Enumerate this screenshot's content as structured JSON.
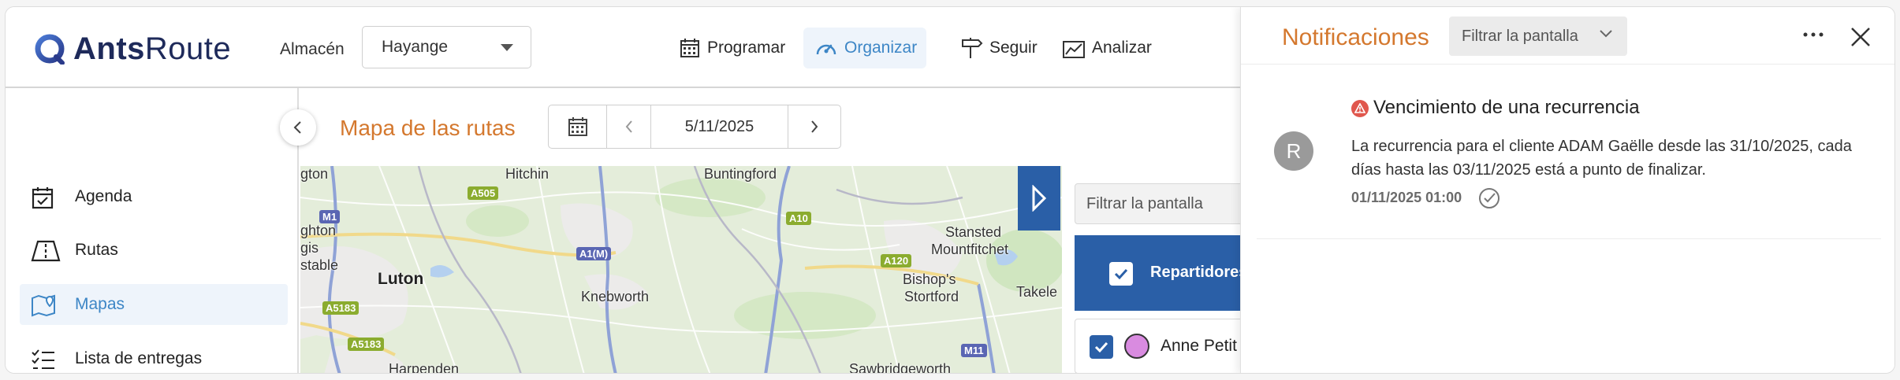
{
  "header": {
    "brand_bold": "Ants",
    "brand_light": "Route",
    "warehouse_label": "Almacén",
    "warehouse_value": "Hayange",
    "nav": [
      {
        "label": "Programar",
        "icon": "calendar-grid-icon"
      },
      {
        "label": "Organizar",
        "icon": "speedometer-icon",
        "active": true
      },
      {
        "label": "Seguir",
        "icon": "signpost-icon"
      },
      {
        "label": "Analizar",
        "icon": "chart-icon"
      }
    ]
  },
  "sidebar": {
    "items": [
      {
        "label": "Agenda",
        "icon": "calendar-check-icon"
      },
      {
        "label": "Rutas",
        "icon": "route-board-icon"
      },
      {
        "label": "Mapas",
        "icon": "map-pin-icon",
        "active": true
      },
      {
        "label": "Lista de entregas",
        "icon": "checklist-icon"
      }
    ]
  },
  "main": {
    "title": "Mapa de las rutas",
    "date": "5/11/2025"
  },
  "map": {
    "places": [
      "gton",
      "ghton",
      "gis",
      "stable",
      "Luton",
      "Hitchin",
      "Knebworth",
      "Buntingford",
      "Stansted",
      "Mountfitchet",
      "Bishop's",
      "Stortford",
      "Takele",
      "Harpenden",
      "Sawbridgeworth"
    ],
    "roads": [
      "M1",
      "A505",
      "A1(M)",
      "A10",
      "A120",
      "A5183",
      "A5183",
      "M11"
    ]
  },
  "right_panel": {
    "filter": "Filtrar la pantalla",
    "drivers_header": "Repartidores",
    "driver_name": "Anne Petit"
  },
  "notifications": {
    "title": "Notificaciones",
    "filter": "Filtrar la pantalla",
    "item": {
      "avatar": "R",
      "title": "Vencimiento de una recurrencia",
      "body": "La recurrencia para el cliente ADAM Gaëlle desde las 31/10/2025, cada días hasta las 03/11/2025 está a punto de finalizar.",
      "time": "01/11/2025 01:00"
    }
  },
  "colors": {
    "accent_orange": "#d4782e",
    "accent_blue": "#3d86c6",
    "dark_blue": "#2a5fa7",
    "brand_navy": "#1e2a5a"
  }
}
